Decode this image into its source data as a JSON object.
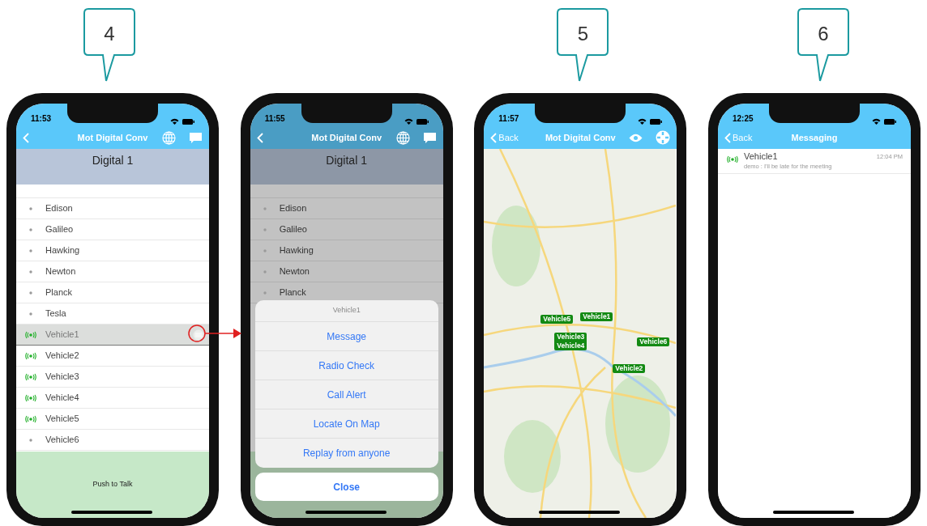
{
  "phones": [
    {
      "kind": "list",
      "callout": "4",
      "time": "11:53",
      "nav": {
        "title": "Mot Digital Conv"
      },
      "header": "Digital 1",
      "contacts": [
        {
          "name": "Edison",
          "kind": "dot",
          "selected": false
        },
        {
          "name": "Galileo",
          "kind": "dot",
          "selected": false
        },
        {
          "name": "Hawking",
          "kind": "dot",
          "selected": false
        },
        {
          "name": "Newton",
          "kind": "dot",
          "selected": false
        },
        {
          "name": "Planck",
          "kind": "dot",
          "selected": false
        },
        {
          "name": "Tesla",
          "kind": "dot",
          "selected": false
        },
        {
          "name": "Vehicle1",
          "kind": "radio",
          "selected": true
        },
        {
          "name": "Vehicle2",
          "kind": "radio",
          "selected": false
        },
        {
          "name": "Vehicle3",
          "kind": "radio",
          "selected": false
        },
        {
          "name": "Vehicle4",
          "kind": "radio",
          "selected": false
        },
        {
          "name": "Vehicle5",
          "kind": "radio",
          "selected": false
        },
        {
          "name": "Vehicle6",
          "kind": "dot",
          "selected": false
        }
      ],
      "ptt": "Push to Talk"
    },
    {
      "kind": "action_sheet",
      "time": "11:55",
      "nav": {
        "title": "Mot Digital Conv"
      },
      "header": "Digital 1",
      "contacts": [
        {
          "name": "Edison",
          "kind": "dot",
          "selected": false
        },
        {
          "name": "Galileo",
          "kind": "dot",
          "selected": false
        },
        {
          "name": "Hawking",
          "kind": "dot",
          "selected": false
        },
        {
          "name": "Newton",
          "kind": "dot",
          "selected": false
        },
        {
          "name": "Planck",
          "kind": "dot",
          "selected": false
        }
      ],
      "sheet": {
        "title": "Vehicle1",
        "actions": [
          "Message",
          "Radio Check",
          "Call Alert",
          "Locate On Map",
          "Replay from anyone"
        ],
        "cancel": "Close"
      }
    },
    {
      "kind": "map",
      "callout": "5",
      "time": "11:57",
      "nav": {
        "back": "Back",
        "title": "Mot Digital Conv"
      },
      "markers": [
        {
          "labels": [
            "Vehicle5"
          ]
        },
        {
          "labels": [
            "Vehicle1"
          ]
        },
        {
          "labels": [
            "Vehicle3",
            "Vehicle4"
          ]
        },
        {
          "labels": [
            "Vehicle6"
          ]
        },
        {
          "labels": [
            "Vehicle2"
          ]
        }
      ]
    },
    {
      "kind": "messaging",
      "callout": "6",
      "time": "12:25",
      "nav": {
        "back": "Back",
        "title": "Messaging"
      },
      "messages": [
        {
          "name": "Vehicle1",
          "preview": "demo : I'll be late for the meeting",
          "time": "12:04 PM"
        }
      ]
    }
  ]
}
